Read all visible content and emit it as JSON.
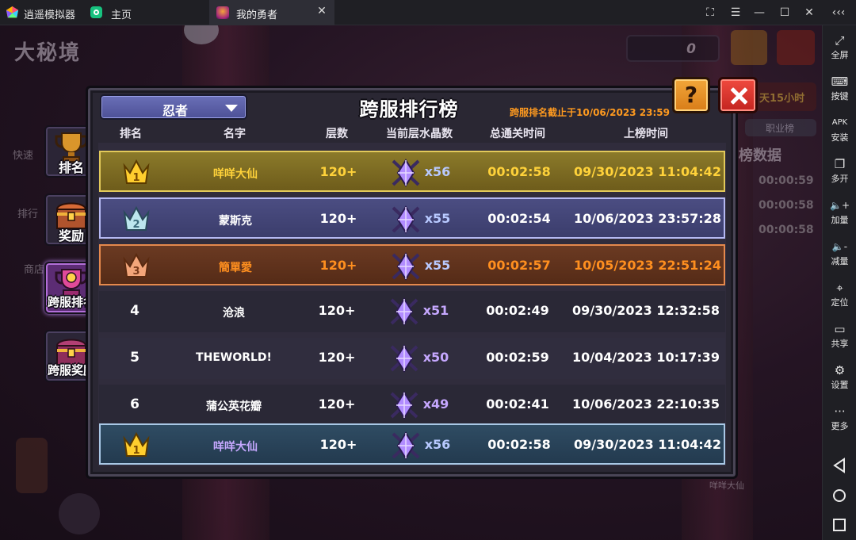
{
  "titlebar": {
    "app_name": "逍遥模拟器",
    "home_tab": "主页",
    "game_tab": "我的勇者",
    "game_tab_close": "✕",
    "win_controls": [
      "⛶",
      "☰",
      "—",
      "☐",
      "✕",
      "‹‹‹"
    ]
  },
  "sidebar": {
    "items": [
      {
        "icon": "fullscreen-icon",
        "glyph": "⤢",
        "label": "全屏"
      },
      {
        "icon": "keyboard-icon",
        "glyph": "⌨",
        "label": "按键"
      },
      {
        "icon": "apk-icon",
        "glyph": "APK",
        "label": "安装"
      },
      {
        "icon": "multi-window-icon",
        "glyph": "❐",
        "label": "多开"
      },
      {
        "icon": "volume-up-icon",
        "glyph": "🔈+",
        "label": "加量"
      },
      {
        "icon": "volume-down-icon",
        "glyph": "🔈-",
        "label": "减量"
      },
      {
        "icon": "location-icon",
        "glyph": "⌖",
        "label": "定位"
      },
      {
        "icon": "folder-icon",
        "glyph": "▭",
        "label": "共享"
      },
      {
        "icon": "gear-icon",
        "glyph": "⚙",
        "label": "设置"
      },
      {
        "icon": "more-icon",
        "glyph": "···",
        "label": "更多"
      }
    ]
  },
  "background": {
    "title": "大秘境",
    "score": "0",
    "side_labels": [
      "快速",
      "排行",
      "商店"
    ],
    "tab_label": "职业榜",
    "panel_label": "榜数据",
    "times": [
      "00:00:59",
      "00:00:58",
      "00:00:58"
    ],
    "days_left": "天15小时",
    "player_name": "咩咩大仙"
  },
  "menu": [
    {
      "label": "排名",
      "active": false
    },
    {
      "label": "奖励",
      "active": false
    },
    {
      "label": "跨服排名",
      "active": true
    },
    {
      "label": "跨服奖励",
      "active": false
    }
  ],
  "panel": {
    "class_dropdown": "忍者",
    "title": "跨服排行榜",
    "cutoff_text": "跨服排名截止于10/06/2023 23:59",
    "help_label": "?",
    "columns": [
      "排名",
      "名字",
      "层数",
      "当前层水晶数",
      "总通关时间",
      "上榜时间"
    ]
  },
  "rows": [
    {
      "rank": "1",
      "name": "咩咩大仙",
      "floors": "120+",
      "crystals": "x56",
      "total_time": "00:02:58",
      "listed_time": "09/30/2023 11:04:42",
      "tier": "gold"
    },
    {
      "rank": "2",
      "name": "蒙斯克",
      "floors": "120+",
      "crystals": "x55",
      "total_time": "00:02:54",
      "listed_time": "10/06/2023 23:57:28",
      "tier": "silver"
    },
    {
      "rank": "3",
      "name": "簡單愛",
      "floors": "120+",
      "crystals": "x55",
      "total_time": "00:02:57",
      "listed_time": "10/05/2023 22:51:24",
      "tier": "bronze"
    },
    {
      "rank": "4",
      "name": "沧浪",
      "floors": "120+",
      "crystals": "x51",
      "total_time": "00:02:49",
      "listed_time": "09/30/2023 12:32:58",
      "tier": "normal"
    },
    {
      "rank": "5",
      "name": "THEWORLD!",
      "floors": "120+",
      "crystals": "x50",
      "total_time": "00:02:59",
      "listed_time": "10/04/2023 10:17:39",
      "tier": "normal"
    },
    {
      "rank": "6",
      "name": "蒲公英花瓣",
      "floors": "120+",
      "crystals": "x49",
      "total_time": "00:02:41",
      "listed_time": "10/06/2023 22:10:35",
      "tier": "normal"
    }
  ],
  "my_row": {
    "rank": "1",
    "name": "咩咩大仙",
    "floors": "120+",
    "crystals": "x56",
    "total_time": "00:02:58",
    "listed_time": "09/30/2023 11:04:42"
  },
  "colors": {
    "gold": "#ffd23a",
    "silver_border": "#b5b9f2",
    "bronze": "#ff8f1f",
    "cutoff": "#ff9a1f",
    "accent_purple": "#c6a8ff"
  }
}
